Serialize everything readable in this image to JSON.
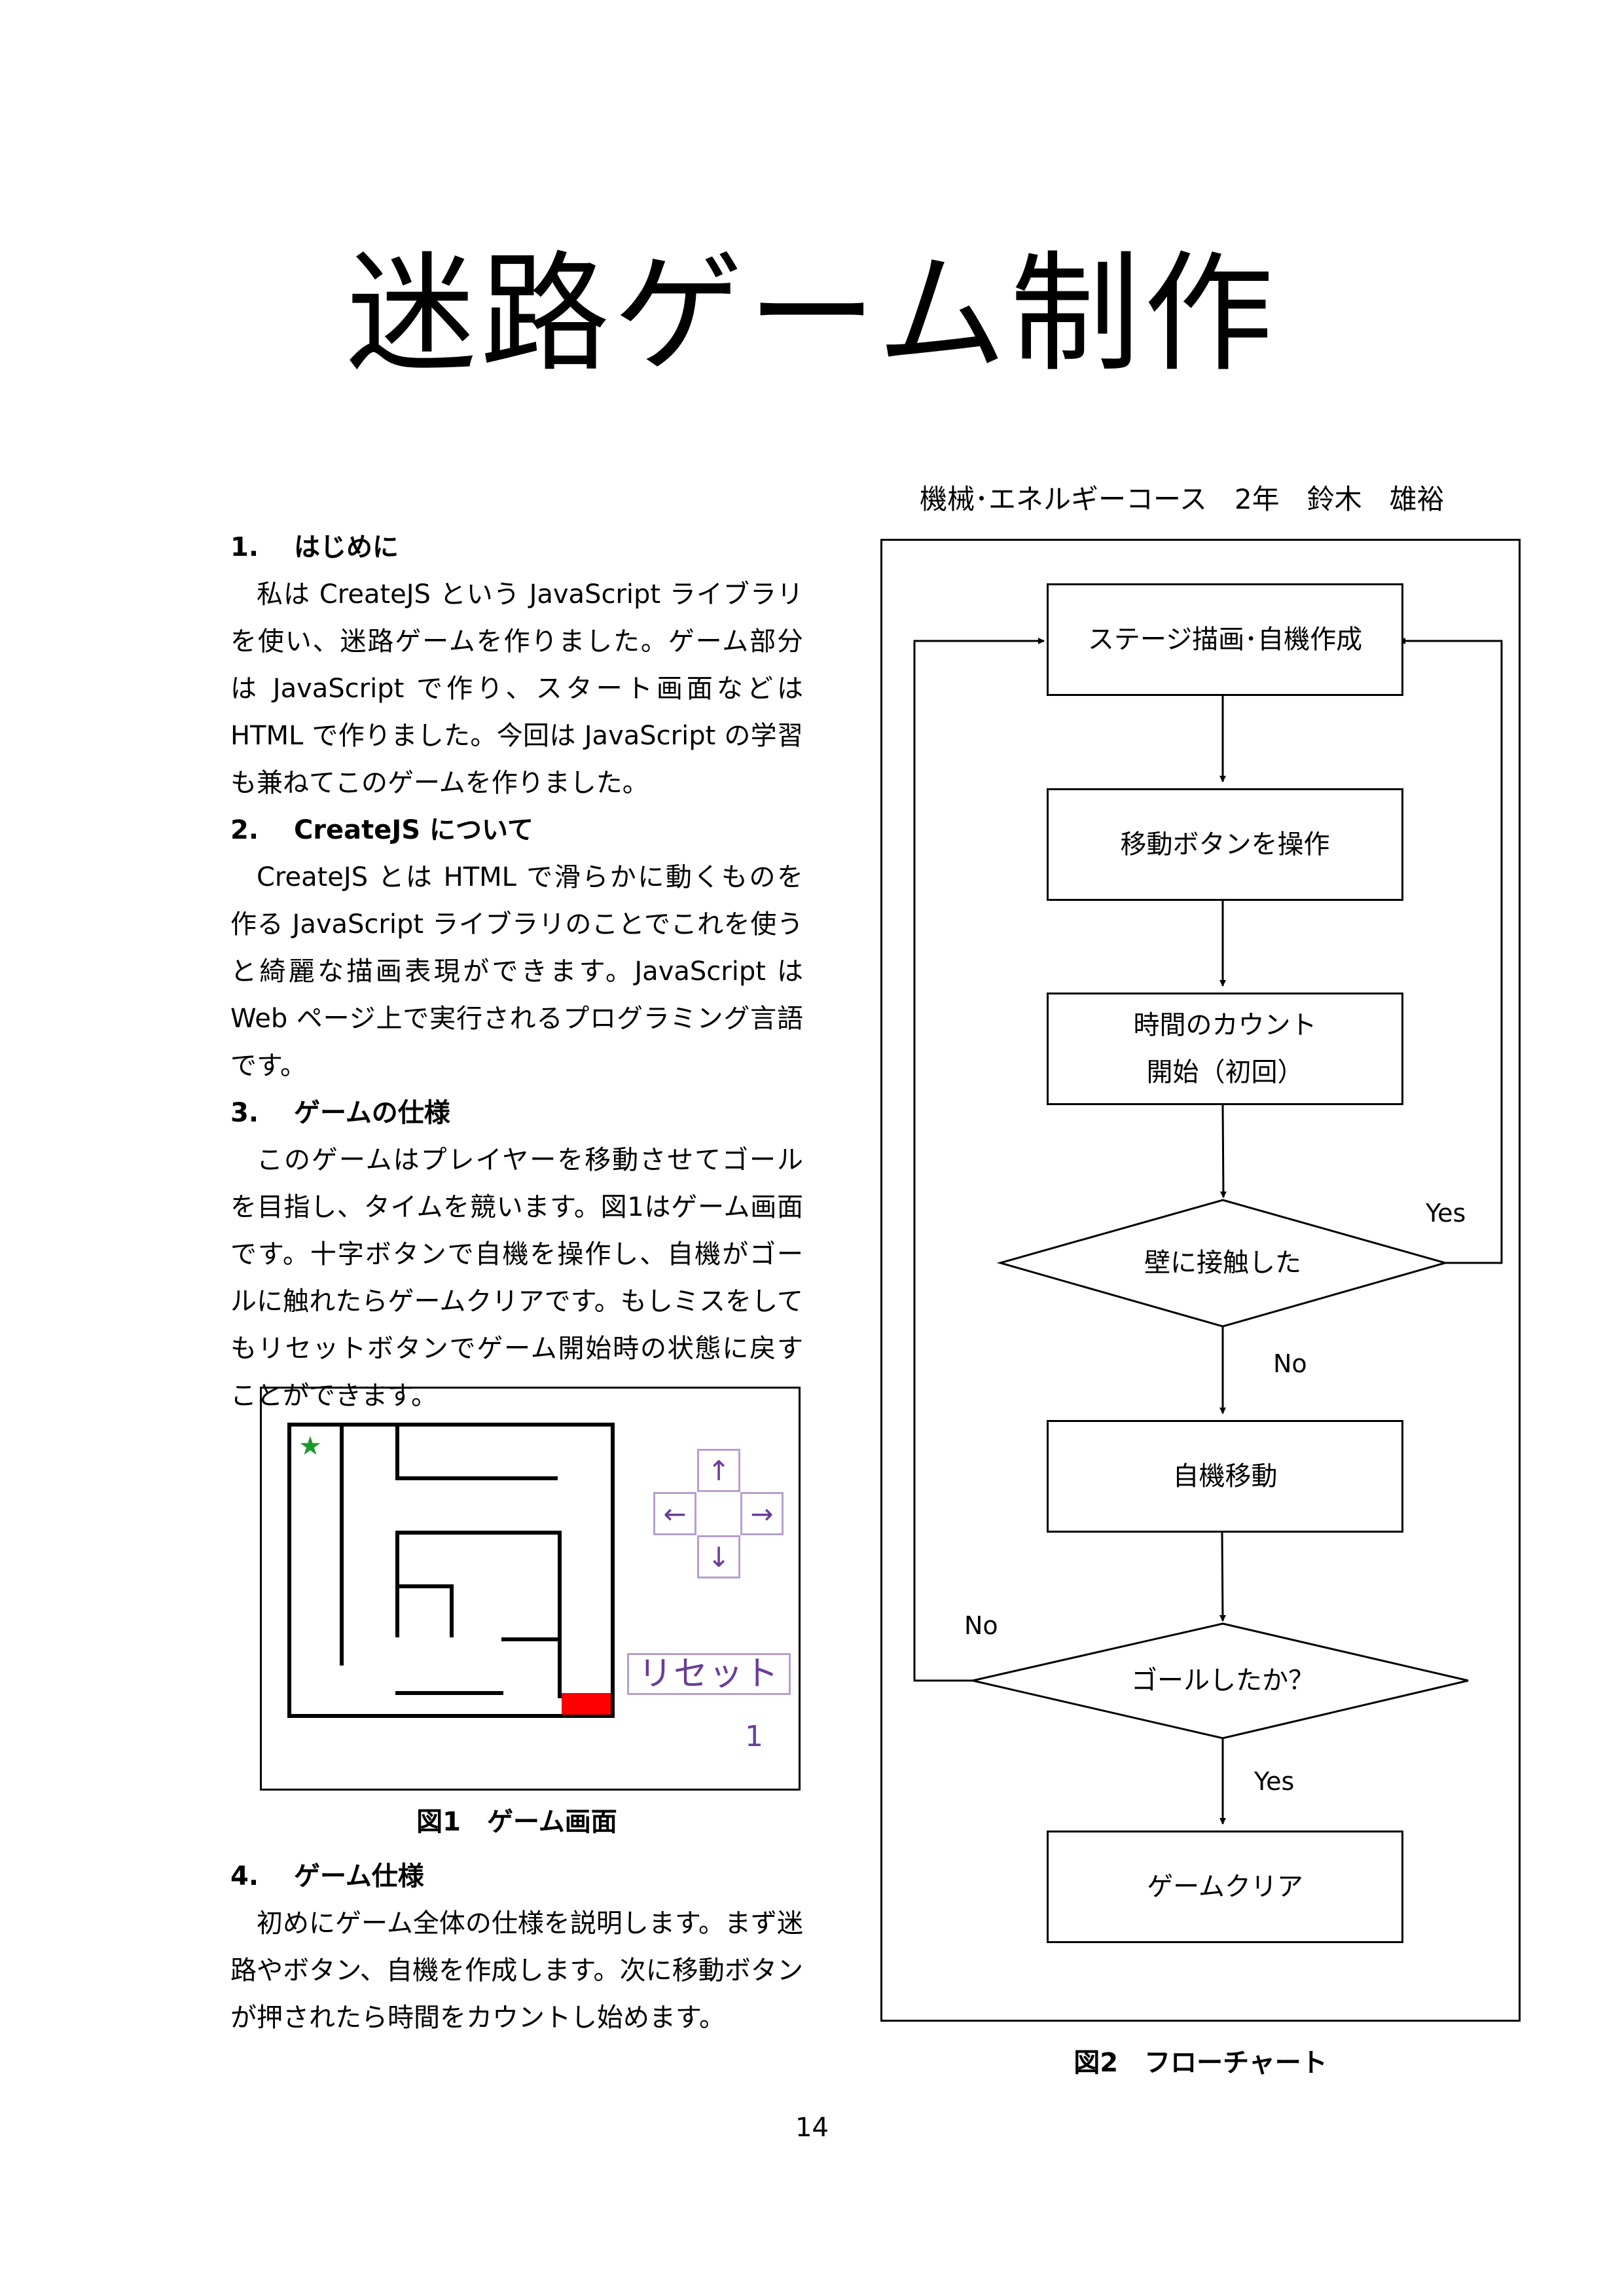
{
  "title": "迷路ゲーム制作",
  "author": "機械･エネルギーコース　2年　鈴木　雄裕",
  "sections": [
    {
      "heading": "1.　 はじめに",
      "paragraphs": [
        "私は CreateJS という JavaScript ライブラリを使い、迷路ゲームを作りました。ゲーム部分は JavaScript で作り、スタート画面などは HTML で作りました。今回は JavaScript の学習も兼ねてこのゲームを作りました。"
      ]
    },
    {
      "heading": "2.　 CreateJS について",
      "paragraphs": [
        "CreateJS とは HTML で滑らかに動くものを作る JavaScript ライブラリのことでこれを使うと綺麗な描画表現ができます。JavaScript は Web ページ上で実行されるプログラミング言語です。"
      ]
    },
    {
      "heading": "3.　 ゲームの仕様",
      "paragraphs": [
        "このゲームはプレイヤーを移動させてゴールを目指し、タイムを競います。図1はゲーム画面です。十字ボタンで自機を操作し、自機がゴールに触れたらゲームクリアです。もしミスをしてもリセットボタンでゲーム開始時の状態に戻すことができます。"
      ]
    },
    {
      "heading": "4.　 ゲーム仕様",
      "paragraphs": [
        "初めにゲーム全体の仕様を説明します。まず迷路やボタン、自機を作成します。次に移動ボタンが押されたら時間をカウントし始めます。"
      ]
    }
  ],
  "figure1": {
    "caption": "図1　ゲーム画面",
    "buttons": {
      "up": "↑",
      "left": "←",
      "right": "→",
      "down": "↓"
    },
    "reset_label": "リセット",
    "counter": "1",
    "player_glyph": "★",
    "colors": {
      "player": "#1a9a2a",
      "goal": "#ff0000",
      "ui": "#6a3d99"
    }
  },
  "figure2": {
    "caption": "図2　フローチャート",
    "nodes": {
      "stage": "ステージ描画･自機作成",
      "operate": "移動ボタンを操作",
      "count_line1": "時間のカウント",
      "count_line2": "開始（初回）",
      "wall": "壁に接触した",
      "move": "自機移動",
      "goal": "ゴールしたか？",
      "clear": "ゲームクリア"
    },
    "labels": {
      "wall_yes": "Yes",
      "wall_no": "No",
      "goal_no": "No",
      "goal_yes": "Yes"
    }
  },
  "page_number": "14"
}
